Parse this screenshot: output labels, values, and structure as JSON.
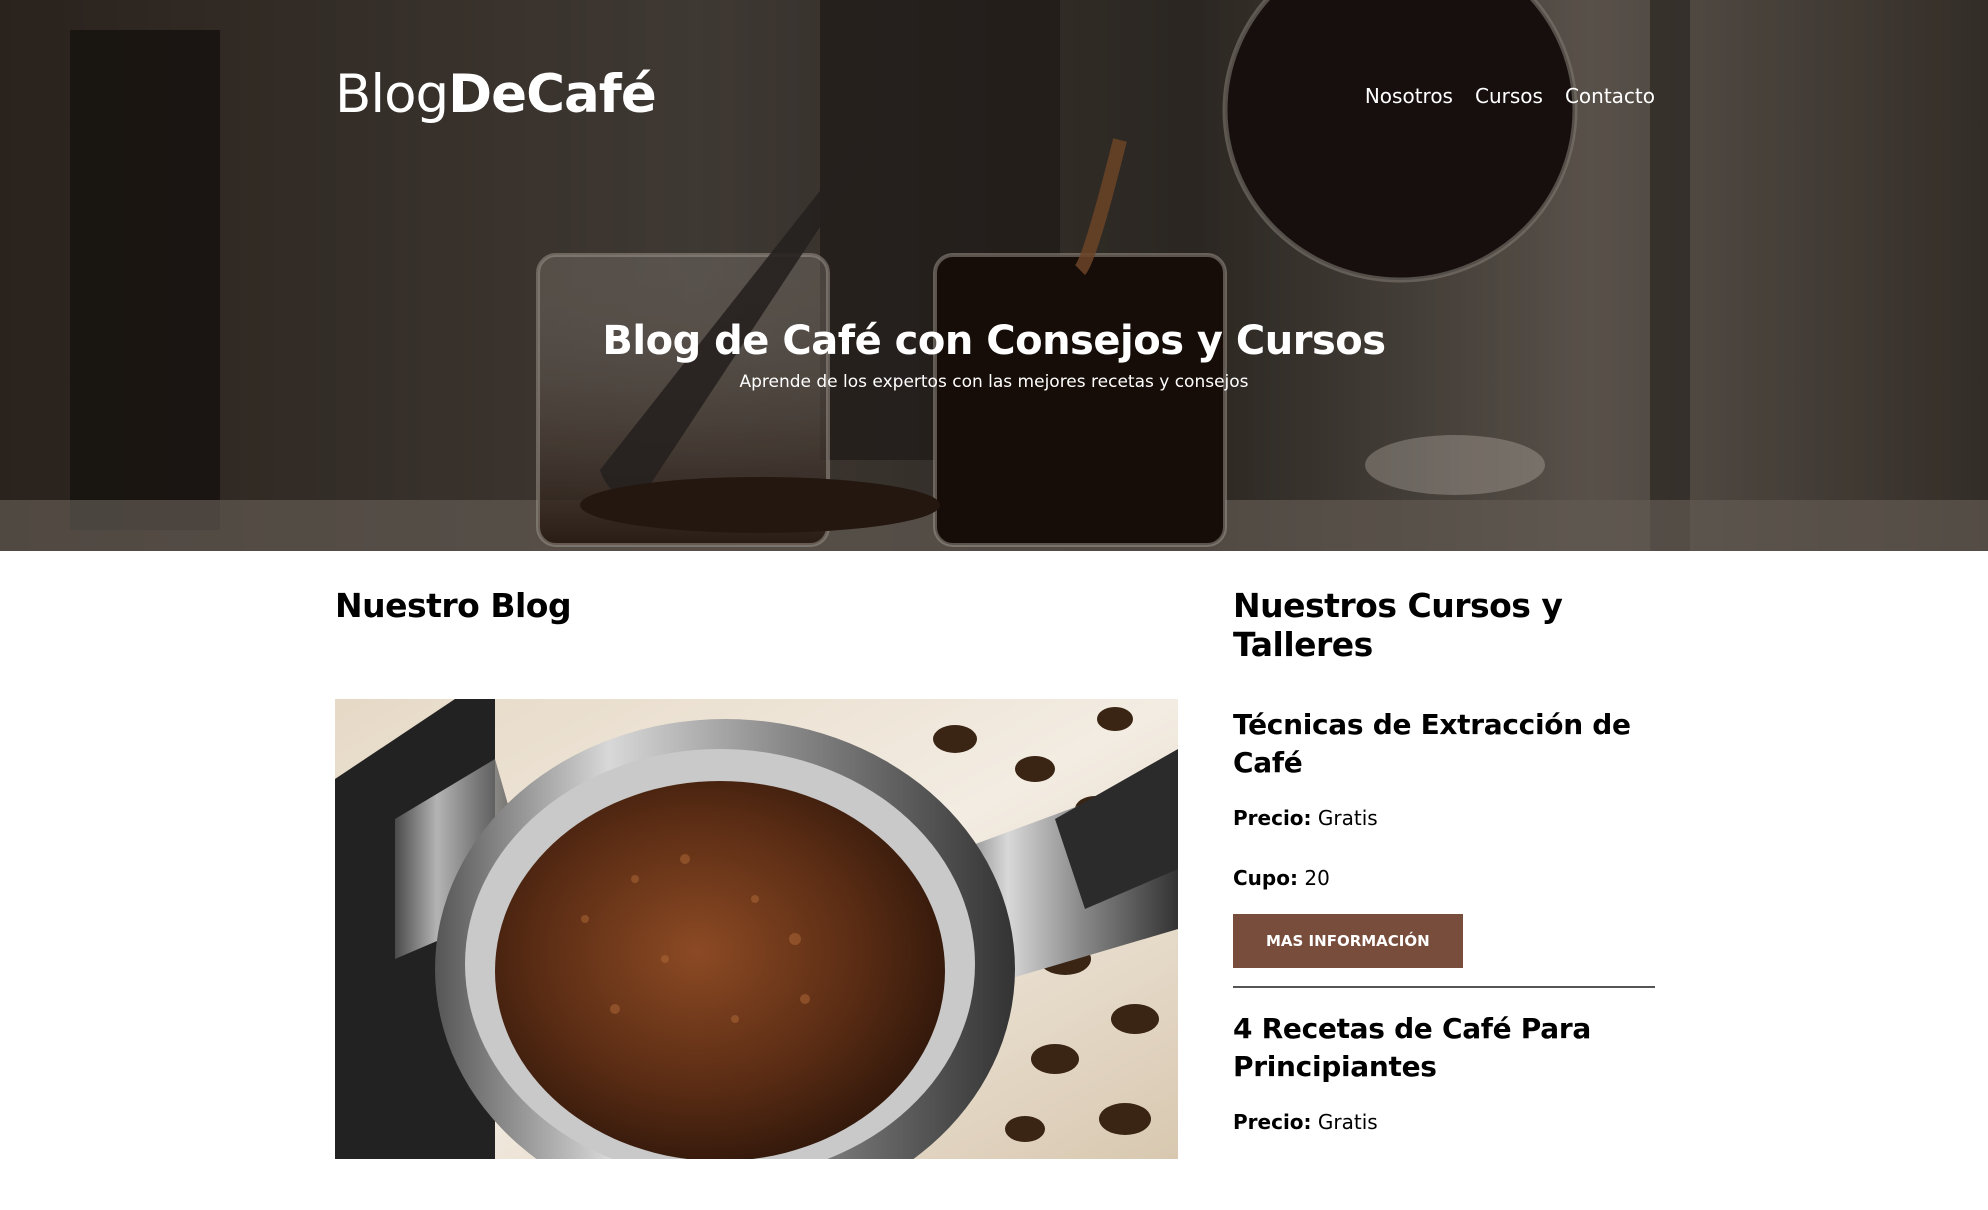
{
  "header": {
    "logo_light": "Blog",
    "logo_bold": "DeCafé",
    "nav": [
      {
        "label": "Nosotros"
      },
      {
        "label": "Cursos"
      },
      {
        "label": "Contacto"
      }
    ]
  },
  "hero": {
    "title": "Blog de Café con Consejos y Cursos",
    "subtitle": "Aprende de los expertos con las mejores recetas y consejos"
  },
  "blog": {
    "title": "Nuestro Blog"
  },
  "courses": {
    "title": "Nuestros Cursos y Talleres",
    "items": [
      {
        "title": "Técnicas de Extracción de Café",
        "price_label": "Precio:",
        "price": "Gratis",
        "cupo_label": "Cupo:",
        "cupo": "20",
        "button": "MAS INFORMACIÓN"
      },
      {
        "title": "4 Recetas de Café Para Principiantes",
        "price_label": "Precio:",
        "price": "Gratis"
      }
    ]
  },
  "colors": {
    "accent": "#784d3c",
    "hero_dark": "#2e2622"
  }
}
